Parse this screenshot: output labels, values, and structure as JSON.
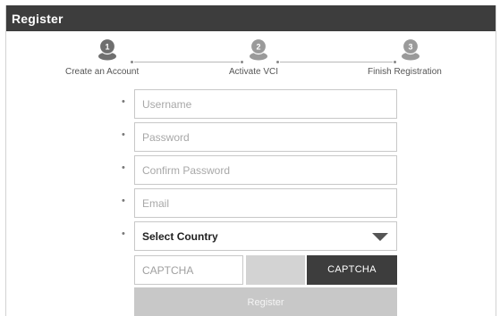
{
  "window": {
    "title": "Register"
  },
  "steps": [
    {
      "number": "1",
      "label": "Create an Account",
      "state": "active"
    },
    {
      "number": "2",
      "label": "Activate VCI",
      "state": "inactive"
    },
    {
      "number": "3",
      "label": "Finish Registration",
      "state": "inactive"
    }
  ],
  "colors": {
    "titlebar": "#3d3d3d",
    "step_active": "#6f6f6f",
    "step_inactive": "#9a9a9a",
    "captcha_button": "#3d3d3d",
    "register_button": "#c8c8c8"
  },
  "form": {
    "required_marker": "•",
    "username": {
      "placeholder": "Username",
      "value": ""
    },
    "password": {
      "placeholder": "Password",
      "value": ""
    },
    "confirm_password": {
      "placeholder": "Confirm Password",
      "value": ""
    },
    "email": {
      "placeholder": "Email",
      "value": ""
    },
    "country": {
      "selected": "Select Country",
      "icon": "chevron-down-icon"
    },
    "captcha": {
      "placeholder": "CAPTCHA",
      "value": "",
      "button_label": "CAPTCHA"
    },
    "register_label": "Register"
  }
}
